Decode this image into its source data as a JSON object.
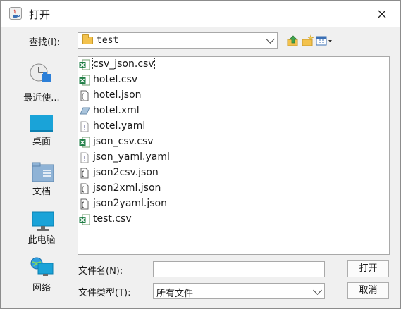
{
  "window": {
    "title": "打开"
  },
  "toolbar": {
    "look_in_label": "查找(I):",
    "look_in_value": "test",
    "buttons": [
      "up-one-level-icon",
      "create-new-folder-icon",
      "view-menu-icon"
    ]
  },
  "places": [
    {
      "label": "最近使...",
      "icon": "recent-items-icon"
    },
    {
      "label": "桌面",
      "icon": "desktop-icon"
    },
    {
      "label": "文档",
      "icon": "documents-icon"
    },
    {
      "label": "此电脑",
      "icon": "computer-icon"
    },
    {
      "label": "网络",
      "icon": "network-icon"
    }
  ],
  "files": [
    {
      "name": "csv_json.csv",
      "icon": "excel-icon"
    },
    {
      "name": "hotel.csv",
      "icon": "excel-icon"
    },
    {
      "name": "hotel.json",
      "icon": "json-file-icon"
    },
    {
      "name": "hotel.xml",
      "icon": "xml-file-icon"
    },
    {
      "name": "hotel.yaml",
      "icon": "yaml-file-icon"
    },
    {
      "name": "json_csv.csv",
      "icon": "excel-icon"
    },
    {
      "name": "json_yaml.yaml",
      "icon": "yaml-file-icon"
    },
    {
      "name": "json2csv.json",
      "icon": "json-file-icon"
    },
    {
      "name": "json2xml.json",
      "icon": "json-file-icon"
    },
    {
      "name": "json2yaml.json",
      "icon": "json-file-icon"
    },
    {
      "name": "test.csv",
      "icon": "excel-icon"
    }
  ],
  "form": {
    "filename_label": "文件名(N):",
    "filename_value": "",
    "filetype_label": "文件类型(T):",
    "filetype_value": "所有文件"
  },
  "buttons": {
    "open": "打开",
    "cancel": "取消"
  }
}
